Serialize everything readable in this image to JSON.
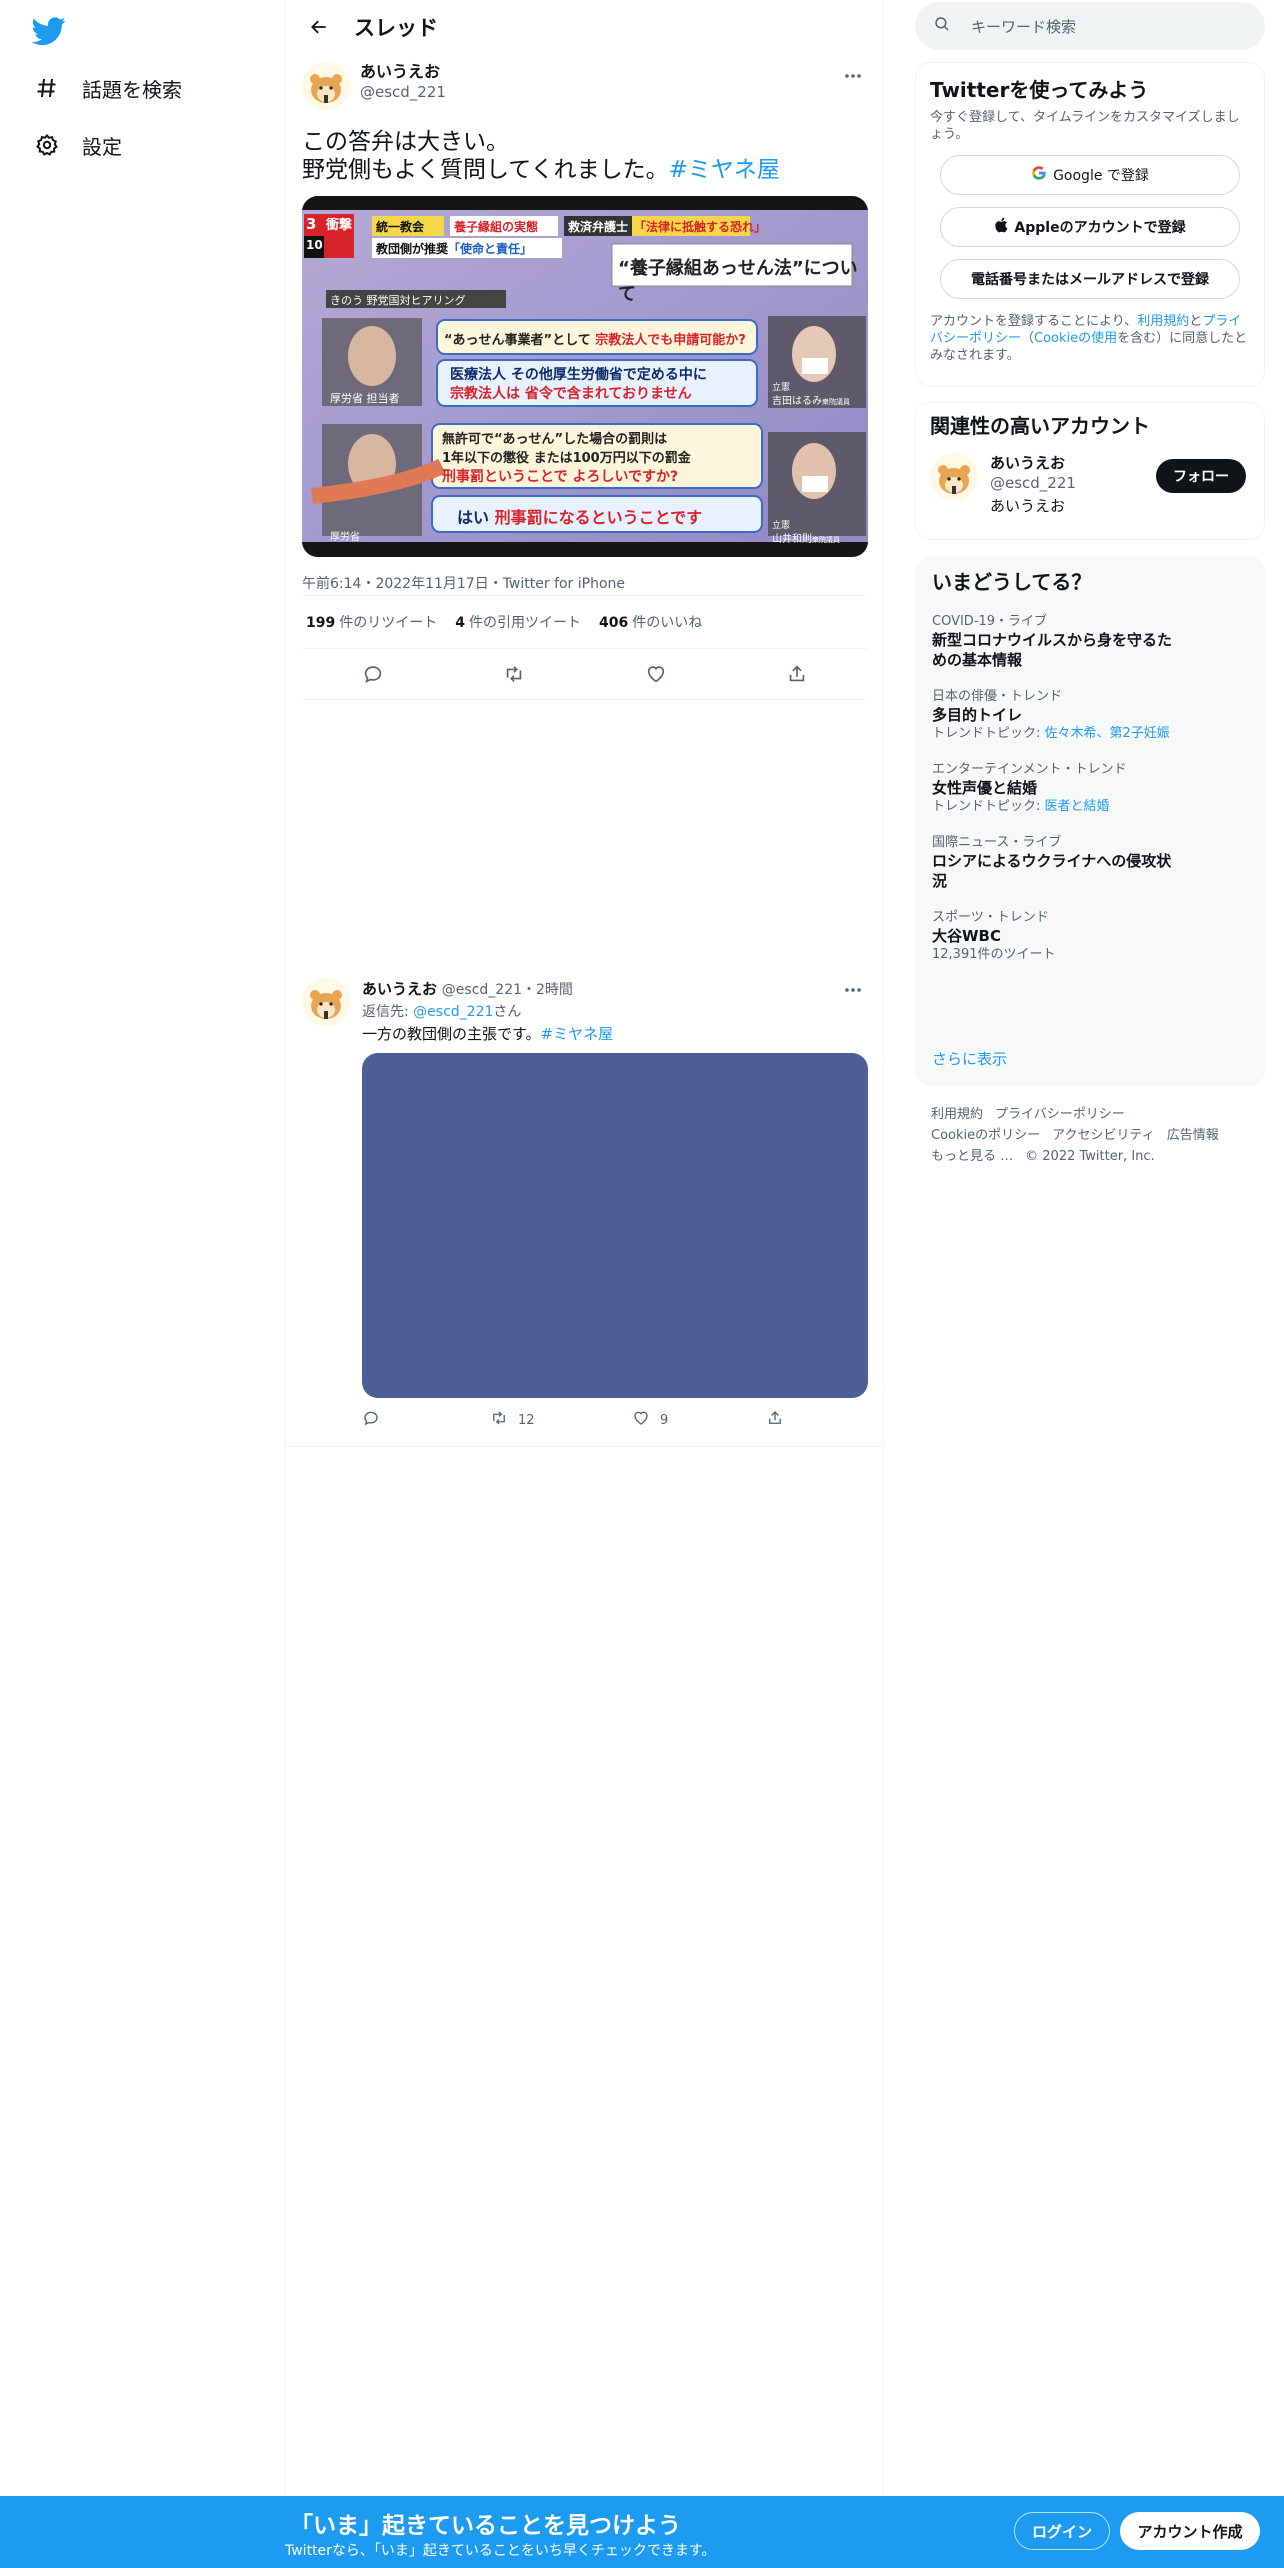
{
  "nav": {
    "explore_label": "話題を検索",
    "settings_label": "設定"
  },
  "header": {
    "title": "スレッド"
  },
  "tweet": {
    "display_name": "あいうえお",
    "handle": "@escd_221",
    "text_line1": "この答弁は大きい。",
    "text_line2": "野党側もよく質問してくれました。",
    "hashtag": "#ミヤネ屋",
    "meta": "午前6:14・2022年11月17日・Twitter for iPhone",
    "retweets_count": "199",
    "retweets_label": "件のリツイート",
    "quotes_count": "4",
    "quotes_label": "件の引用ツイート",
    "likes_count": "406",
    "likes_label": "件のいいね"
  },
  "media": {
    "badge_num": "3",
    "badge_num2": "10",
    "badge_shock": "衝撃",
    "tag1": "統一教会",
    "tag2": "養子縁組の実態",
    "tag3": "救済弁護士",
    "tag4": "「法律に抵触する恐れ」",
    "sub_left": "教団側が推奨",
    "sub_left_hl": "「使命と責任」",
    "law_title": "“養子縁組あっせん法”について",
    "hearing": "きのう 野党国対ヒアリング",
    "q1a": "“あっせん事業者”として",
    "q1b": "宗教法人でも申請可能か?",
    "a1a": "医療法人 その他厚生労働省で定める中に",
    "a1b": "宗教法人は 省令で含まれておりません",
    "q2a": "無許可で“あっせん”した場合の罰則は",
    "q2b": "1年以下の懲役 または100万円以下の罰金",
    "q2c": "刑事罰ということで よろしいですか?",
    "a2a": "はい",
    "a2b": "刑事罰になるということです",
    "person1": "厚労省 担当者",
    "person2": "吉田はるみ",
    "person2_tag": "衆院議員",
    "person2_party": "立憲",
    "person3": "山井和則",
    "person3_tag": "衆院議員",
    "person3_party": "立憲",
    "person4": "厚労省"
  },
  "reply": {
    "display_name": "あいうえお",
    "handle": "@escd_221",
    "time": "・2時間",
    "reply_to_label": "返信先: ",
    "reply_to_handle": "@escd_221",
    "reply_to_suffix": "さん",
    "text": "一方の教団側の主張です。",
    "hashtag": "#ミヤネ屋",
    "retweets": "12",
    "likes": "9"
  },
  "search": {
    "placeholder": "キーワード検索"
  },
  "signup": {
    "title": "Twitterを使ってみよう",
    "subtitle": "今すぐ登録して、タイムラインをカスタマイズしましょう。",
    "google": "Google で登録",
    "apple": "Appleのアカウントで登録",
    "phone": "電話番号またはメールアドレスで登録",
    "terms_prefix": "アカウントを登録することにより、",
    "terms_link1": "利用規約",
    "terms_and": "と",
    "terms_link2": "プライバシーポリシー",
    "terms_paren_open": "（",
    "terms_link3": "Cookieの使用",
    "terms_suffix": "を含む）に同意したとみなされます。"
  },
  "related": {
    "title": "関連性の高いアカウント",
    "display_name": "あいうえお",
    "handle": "@escd_221",
    "bio": "あいうえお",
    "follow": "フォロー"
  },
  "trends": {
    "title": "いまどうしてる？",
    "items": [
      {
        "context": "COVID-19・ライブ",
        "name": "新型コロナウイルスから身を守るための基本情報",
        "sub_label": "",
        "sub_link": ""
      },
      {
        "context": "日本の俳優・トレンド",
        "name": "多目的トイレ",
        "sub_label": "トレンドトピック: ",
        "sub_link": "佐々木希、第2子妊娠"
      },
      {
        "context": "エンターテインメント・トレンド",
        "name": "女性声優と結婚",
        "sub_label": "トレンドトピック: ",
        "sub_link": "医者と結婚"
      },
      {
        "context": "国際ニュース・ライブ",
        "name": "ロシアによるウクライナへの侵攻状況",
        "sub_label": "",
        "sub_link": ""
      },
      {
        "context": "スポーツ・トレンド",
        "name": "大谷WBC",
        "sub_label": "12,391件のツイート",
        "sub_link": ""
      }
    ],
    "show_more": "さらに表示"
  },
  "footer": {
    "links": [
      "利用規約",
      "プライバシーポリシー",
      "Cookieのポリシー",
      "アクセシビリティ",
      "広告情報",
      "もっと見る …",
      "© 2022 Twitter, Inc."
    ]
  },
  "bottom_bar": {
    "title": "「いま」起きていることを見つけよう",
    "subtitle": "Twitterなら、「いま」起きていることをいち早くチェックできます。",
    "login": "ログイン",
    "signup": "アカウント作成"
  },
  "colors": {
    "accent": "#1d9bf0",
    "reply_media": "#4e5f96",
    "text": "#0f1419",
    "muted": "#536471"
  }
}
